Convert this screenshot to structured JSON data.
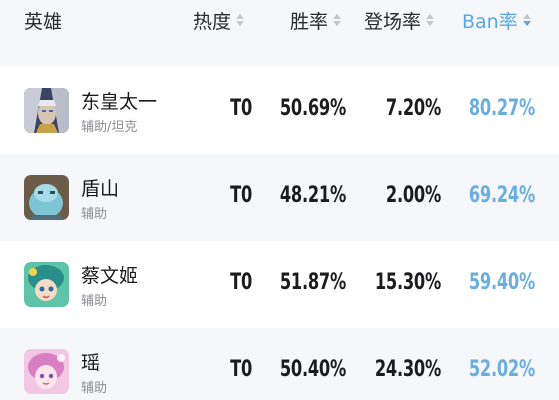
{
  "header": {
    "hero": "英雄",
    "heat": "热度",
    "win_rate": "胜率",
    "pick_rate": "登场率",
    "ban_rate": "Ban率"
  },
  "colors": {
    "accent": "#5aa6e0",
    "ban_value": "#6aaedf",
    "alt_row": "#f6f7fb"
  },
  "rows": [
    {
      "name": "东皇太一",
      "role": "辅助/坦克",
      "tier": "T0",
      "win": "50.69%",
      "pick": "7.20%",
      "ban": "80.27%",
      "avatar": "donghuang-avatar"
    },
    {
      "name": "盾山",
      "role": "辅助",
      "tier": "T0",
      "win": "48.21%",
      "pick": "2.00%",
      "ban": "69.24%",
      "avatar": "dunshan-avatar"
    },
    {
      "name": "蔡文姬",
      "role": "辅助",
      "tier": "T0",
      "win": "51.87%",
      "pick": "15.30%",
      "ban": "59.40%",
      "avatar": "caiwenji-avatar"
    },
    {
      "name": "瑶",
      "role": "辅助",
      "tier": "T0",
      "win": "50.40%",
      "pick": "24.30%",
      "ban": "52.02%",
      "avatar": "yao-avatar"
    }
  ]
}
